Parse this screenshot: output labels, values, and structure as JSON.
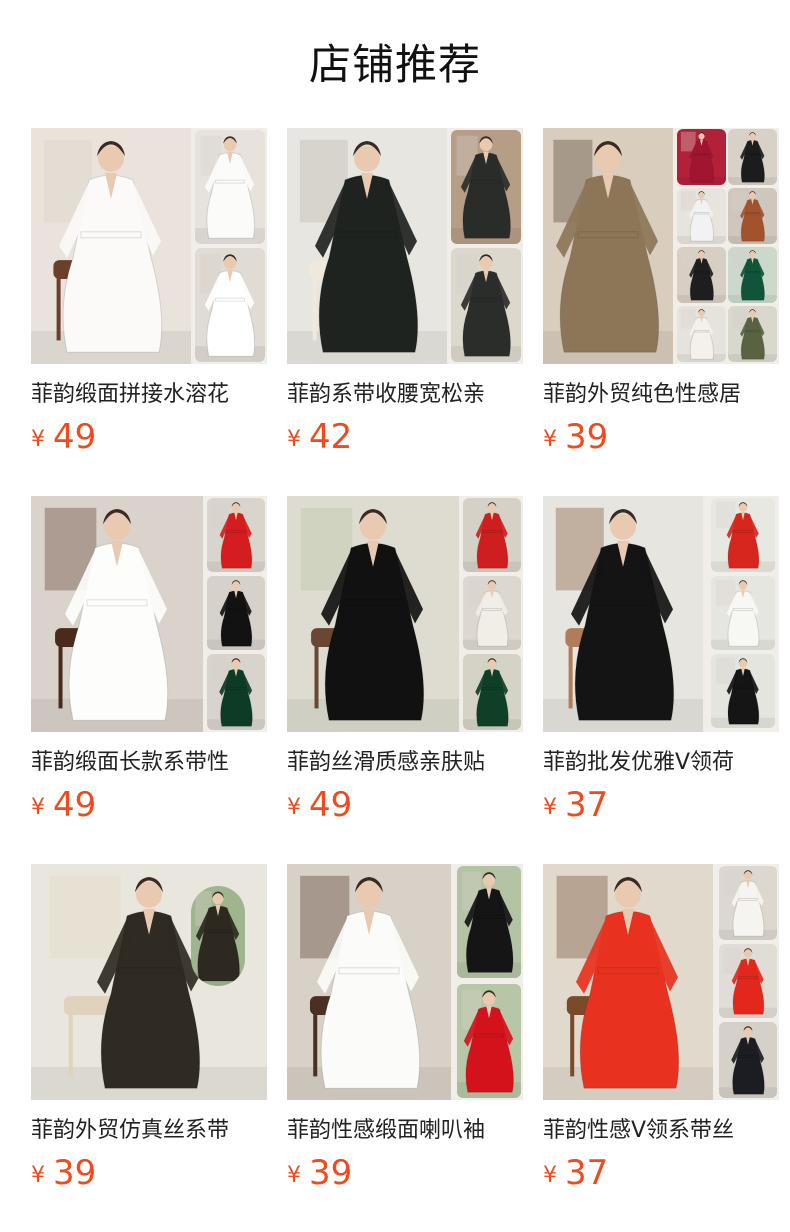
{
  "header": {
    "title": "店铺推荐"
  },
  "products": [
    {
      "title": "菲韵缎面拼接水溶花",
      "currency": "¥",
      "price": "49",
      "main": {
        "bg": "#e9e3dc",
        "garment": "#fbfaf8",
        "accent": "#d9d0c6",
        "chair": "#6b3f2a"
      },
      "sides": [
        {
          "bg": "#e7e2dc",
          "garment": "#fbfbfa"
        },
        {
          "bg": "#e0dbd4",
          "garment": "#ffffff"
        }
      ]
    },
    {
      "title": "菲韵系带收腰宽松亲",
      "currency": "¥",
      "price": "42",
      "main": {
        "bg": "#e8e6e0",
        "garment": "#1f2320",
        "accent": "#b7b3aa",
        "chair": "#efe8dc"
      },
      "sides": [
        {
          "bg": "#b69d86",
          "garment": "#2a2c2a"
        },
        {
          "bg": "#dcd8ce",
          "garment": "#2b2d2b"
        }
      ]
    },
    {
      "title": "菲韵外贸纯色性感居",
      "currency": "¥",
      "price": "39",
      "main": {
        "bg": "#d9cdbe",
        "garment": "#8d7658",
        "accent": "#4a3a2c",
        "chair": "#d9cdbe"
      },
      "sides": [
        {
          "bg": "#b3203a",
          "garment": "#a01530"
        },
        {
          "bg": "#d8d1c8",
          "garment": "#1c1c1c"
        },
        {
          "bg": "#e7e4de",
          "garment": "#f2f2f2"
        },
        {
          "bg": "#cfc7bd",
          "garment": "#a2532c"
        },
        {
          "bg": "#d7cfc3",
          "garment": "#1e1e1e"
        },
        {
          "bg": "#ccd8cc",
          "garment": "#10553a"
        },
        {
          "bg": "#e6e2dc",
          "garment": "#f4f0ec"
        },
        {
          "bg": "#d8d8cc",
          "garment": "#596241"
        }
      ]
    },
    {
      "title": "菲韵缎面长款系带性",
      "currency": "¥",
      "price": "49",
      "main": {
        "bg": "#d9d3cb",
        "garment": "#fdfdfc",
        "accent": "#5b3625",
        "chair": "#4a2a1d"
      },
      "sides": [
        {
          "bg": "#d9d4cc",
          "garment": "#d51d1f"
        },
        {
          "bg": "#d6d1ca",
          "garment": "#121212"
        },
        {
          "bg": "#d8d3cc",
          "garment": "#0e3b26"
        }
      ]
    },
    {
      "title": "菲韵丝滑质感亲肤贴",
      "currency": "¥",
      "price": "49",
      "main": {
        "bg": "#dedcd1",
        "garment": "#111111",
        "accent": "#b5c49f",
        "chair": "#6a4732"
      },
      "sides": [
        {
          "bg": "#d6d1c7",
          "garment": "#cf1e20"
        },
        {
          "bg": "#dcd8d0",
          "garment": "#f1ede7"
        },
        {
          "bg": "#d4d3c5",
          "garment": "#0f3f27"
        }
      ]
    },
    {
      "title": "菲韵批发优雅V领荷",
      "currency": "¥",
      "price": "37",
      "main": {
        "bg": "#e6e5df",
        "garment": "#141414",
        "accent": "#7a4a2a",
        "chair": "#b07c5a"
      },
      "sides": [
        {
          "bg": "#e8e8e2",
          "garment": "#d7261d"
        },
        {
          "bg": "#e6e6e0",
          "garment": "#f7f7f4"
        },
        {
          "bg": "#e5e5e0",
          "garment": "#151515"
        }
      ]
    },
    {
      "title": "菲韵外贸仿真丝系带",
      "currency": "¥",
      "price": "39",
      "main": {
        "bg": "#e8e6dd",
        "garment": "#2f2a22",
        "accent": "#e6d7c0",
        "chair": "#e0d2bd"
      },
      "sides": [
        {
          "bg": "#9fb58e",
          "garment": "#2d2820"
        }
      ]
    },
    {
      "title": "菲韵性感缎面喇叭袖",
      "currency": "¥",
      "price": "39",
      "main": {
        "bg": "#d7d1c7",
        "garment": "#fbfbf9",
        "accent": "#4b2f22",
        "chair": "#4b2f22"
      },
      "sides": [
        {
          "bg": "#b5c3a5",
          "garment": "#151515"
        },
        {
          "bg": "#b7c6a6",
          "garment": "#d4121c"
        }
      ]
    },
    {
      "title": "菲韵性感V领系带丝",
      "currency": "¥",
      "price": "37",
      "main": {
        "bg": "#e2d9cd",
        "garment": "#e8321f",
        "accent": "#6a4126",
        "chair": "#7a4b2a"
      },
      "sides": [
        {
          "bg": "#dcd8d0",
          "garment": "#f6f4f1"
        },
        {
          "bg": "#e0ddd6",
          "garment": "#e2281c"
        },
        {
          "bg": "#d5d1c8",
          "garment": "#1b1d22"
        }
      ]
    }
  ]
}
